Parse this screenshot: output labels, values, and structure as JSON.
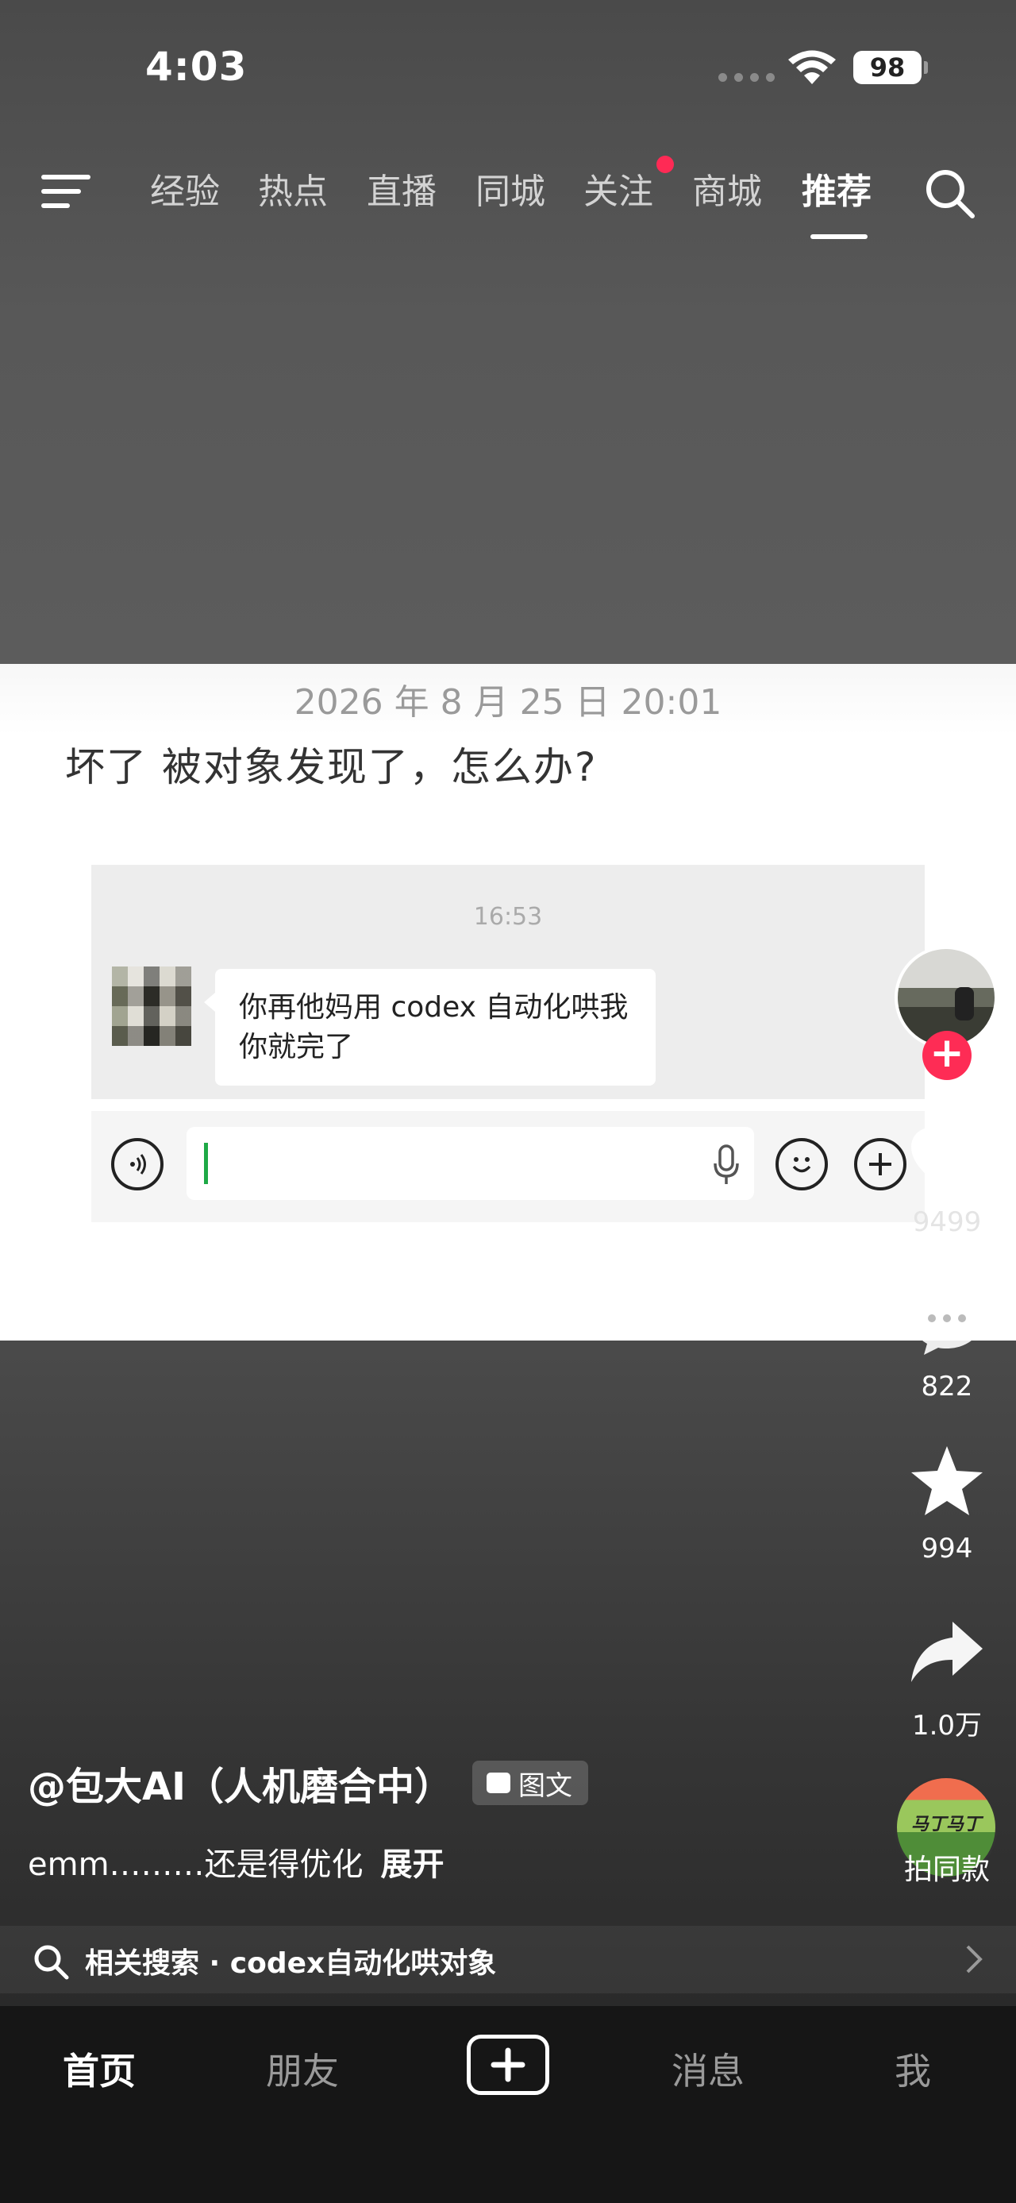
{
  "status_bar": {
    "time": "4:03",
    "battery": "98"
  },
  "top_nav": {
    "tabs": [
      {
        "label": "经验"
      },
      {
        "label": "热点"
      },
      {
        "label": "直播"
      },
      {
        "label": "同城"
      },
      {
        "label": "关注"
      },
      {
        "label": "商城"
      },
      {
        "label": "推荐"
      }
    ],
    "active_tab": "推荐",
    "notification_tab": "关注",
    "accent_color": "#fe2c55"
  },
  "post": {
    "timestamp": "2026 年 8 月 25 日 20:01",
    "text": "坏了 被对象发现了，怎么办?",
    "chat_screenshot": {
      "time": "16:53",
      "message": "你再他妈用 codex 自动化哄我你就完了"
    }
  },
  "rail": {
    "likes": "9499",
    "comments": "822",
    "favorites": "994",
    "shares": "1.0万",
    "music_disc_text": "马丁马丁",
    "same_style_label": "拍同款",
    "icons": [
      "heart-icon",
      "comment-icon",
      "star-icon",
      "share-icon"
    ]
  },
  "info": {
    "author": "@包大AI（人机磨合中）",
    "post_type": "图文",
    "caption": "emm………还是得优化",
    "expand_label": "展开",
    "related_search": "相关搜索 · codex自动化哄对象"
  },
  "bottom_nav": {
    "home": "首页",
    "friends": "朋友",
    "messages": "消息",
    "me": "我"
  }
}
